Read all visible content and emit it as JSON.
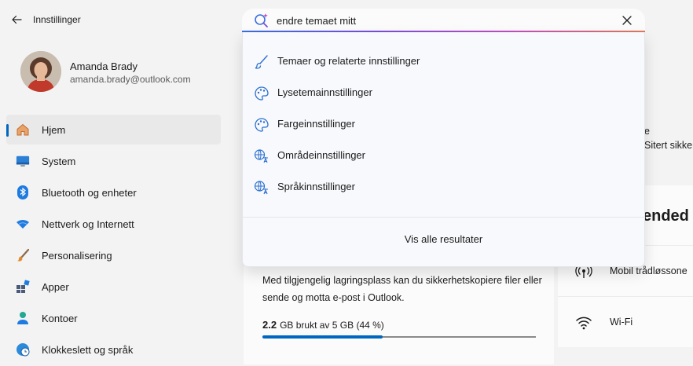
{
  "app": {
    "title": "Innstillinger"
  },
  "profile": {
    "name": "Amanda Brady",
    "email": "amanda.brady@outlook.com"
  },
  "nav": {
    "items": [
      {
        "label": "Hjem",
        "icon": "home-icon",
        "active": true
      },
      {
        "label": "System",
        "icon": "monitor-icon"
      },
      {
        "label": "Bluetooth og enheter",
        "icon": "bluetooth-icon"
      },
      {
        "label": "Nettverk og Internett",
        "icon": "wifi-icon"
      },
      {
        "label": "Personalisering",
        "icon": "brush-icon"
      },
      {
        "label": "Apper",
        "icon": "apps-icon"
      },
      {
        "label": "Kontoer",
        "icon": "person-icon"
      },
      {
        "label": "Klokkeslett og språk",
        "icon": "globe-clock-icon"
      }
    ]
  },
  "search": {
    "value": "endre temaet mitt",
    "results": [
      {
        "label": "Temaer og relaterte innstillinger",
        "icon": "brush-icon"
      },
      {
        "label": "Lysetemainnstillinger",
        "icon": "palette-icon"
      },
      {
        "label": "Fargeinnstillinger",
        "icon": "palette-icon"
      },
      {
        "label": "Områdeinnstillinger",
        "icon": "region-language-icon"
      },
      {
        "label": "Språkinnstillinger",
        "icon": "region-language-icon"
      }
    ],
    "see_all": "Vis alle resultater"
  },
  "storage": {
    "description": "Med tilgjengelig lagringsplass kan du sikkerhetskopiere filer eller sende og motta e-post i Outlook.",
    "used_amount": "2.2",
    "used_text": "GB brukt av 5 GB (44 %)",
    "used_fraction": 0.44
  },
  "right_panel": {
    "text1": "e",
    "text2": "Sitert sikker",
    "rec_title": "ended s",
    "rows": [
      {
        "label": "Mobil trådløssone",
        "icon": "hotspot-icon"
      },
      {
        "label": "Wi-Fi",
        "icon": "wifi-icon"
      }
    ]
  },
  "colors": {
    "accent": "#0067c0",
    "background": "#f3f3f3"
  }
}
